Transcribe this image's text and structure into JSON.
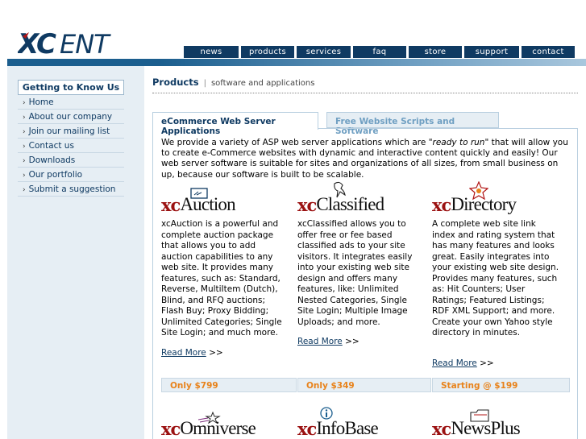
{
  "brand": {
    "logo_text": "XCENT"
  },
  "nav": [
    {
      "label": "news"
    },
    {
      "label": "products"
    },
    {
      "label": "services"
    },
    {
      "label": "faq"
    },
    {
      "label": "store"
    },
    {
      "label": "support"
    },
    {
      "label": "contact"
    }
  ],
  "sidebar": {
    "title": "Getting to Know Us",
    "items": [
      {
        "label": "Home"
      },
      {
        "label": "About our company"
      },
      {
        "label": "Join our mailing list"
      },
      {
        "label": "Contact us"
      },
      {
        "label": "Downloads"
      },
      {
        "label": "Our portfolio"
      },
      {
        "label": "Submit a suggestion"
      }
    ]
  },
  "breadcrumb": {
    "title": "Products",
    "separator": "|",
    "subtitle": "software and applications"
  },
  "tabs": [
    {
      "label": "eCommerce Web Server Applications"
    },
    {
      "label": "Free Website Scripts and Software"
    }
  ],
  "intro": {
    "before": "We provide a variety of ASP web server applications which are \"",
    "emphasis": "ready to run",
    "after": "\" that will allow you to create e-Commerce websites with dynamic and interactive content quickly and easily! Our web server software is suitable for sites and organizations of all sizes, from small business on up, because our software is built to be scalable."
  },
  "products": [
    {
      "prefix": "xc",
      "name": "Auction",
      "icon": "gavel-icon",
      "description": "xcAuction is a powerful and complete auction package that allows you to add auction capabilities to any web site. It provides many features, such as: Standard, Reverse, MultiItem (Dutch), Blind, and RFQ auctions; Flash Buy; Proxy Bidding; Unlimited Categories; Single Site Login; and much more.",
      "read_more": "Read More",
      "arrows": ">>",
      "price": "Only $799"
    },
    {
      "prefix": "xc",
      "name": "Classified",
      "icon": "push-pin-icon",
      "description": "xcClassified allows you to offer free or fee based classified ads to your site visitors. It integrates easily into your existing web site design and offers many features, like: Unlimited Nested Categories, Single Site Login; Multiple Image Uploads; and more.",
      "read_more": "Read More",
      "arrows": ">>",
      "price": "Only $349"
    },
    {
      "prefix": "xc",
      "name": "Directory",
      "icon": "star-badge-icon",
      "description": "A complete web site link index and rating system that has many features and looks great. Easily integrates into your existing web site design. Provides many features, such as: Hit Counters; User Ratings; Featured Listings; RDF XML Support; and more. Create your own Yahoo style directory in minutes.",
      "read_more": "Read More",
      "arrows": ">>",
      "price": "Starting @ $199"
    },
    {
      "prefix": "xc",
      "name": "Omniverse",
      "icon": "shooting-star-icon"
    },
    {
      "prefix": "xc",
      "name": "InfoBase",
      "icon": "info-icon"
    },
    {
      "prefix": "xc",
      "name": "NewsPlus",
      "icon": "folder-icon"
    }
  ],
  "colors": {
    "navy": "#0f3a62",
    "accent_orange": "#e8821a",
    "logo_red": "#9b1111",
    "panel_bg": "#e6eef4"
  }
}
